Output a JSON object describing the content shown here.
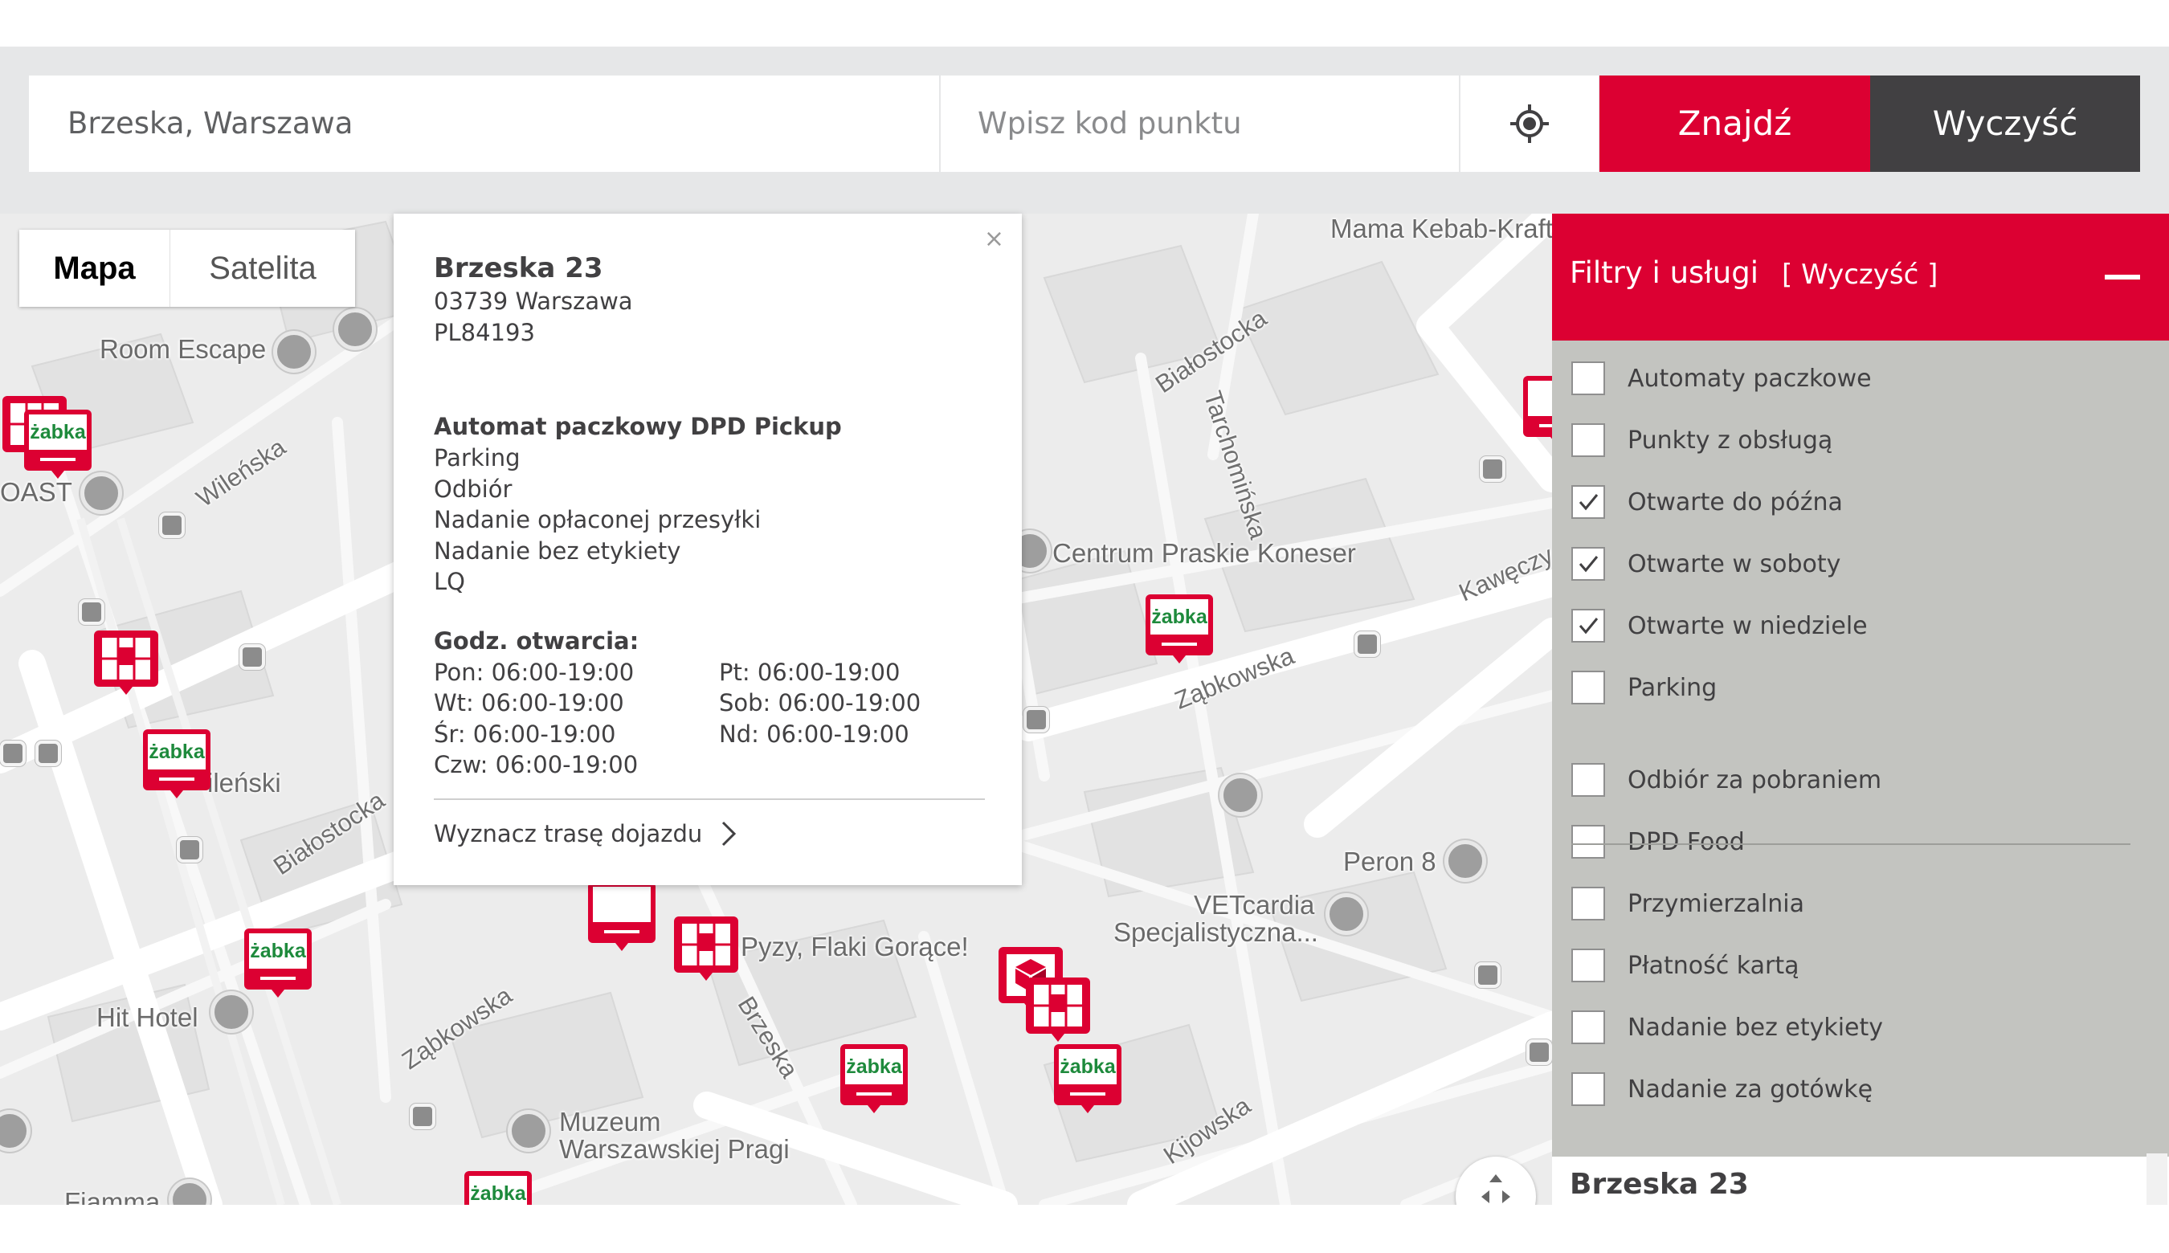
{
  "search": {
    "address_value": "Brzeska, Warszawa",
    "code_placeholder": "Wpisz kod punktu",
    "locate_icon": "crosshair-icon",
    "find_label": "Znajdź",
    "clear_label": "Wyczyść"
  },
  "colors": {
    "brand_red": "#dc0032",
    "dark_gray": "#414042",
    "filter_bg": "#c3c4c0",
    "zabka_green": "#1e8a3c"
  },
  "map": {
    "type_tabs": [
      "Mapa",
      "Satelita"
    ],
    "active_tab": "Mapa",
    "labels": {
      "room_escape": "Room Escape",
      "toast": "OAST",
      "wilenska": "Wileńska",
      "wilenski": "ileński",
      "bialostocka_bottom": "Białostocka",
      "hit_hotel": "Hit Hotel",
      "zabkowska_bottom": "Ząbkowska",
      "brzeska": "Brzeska",
      "pyzy": "Pyzy, Flaki Gorące!",
      "muzeum_1": "Muzeum",
      "muzeum_2": "Warszawskiej Pragi",
      "fiamma": "Fiamma",
      "mama_kebab": "Mama Kebab-Kraft",
      "bialostocka_top": "Białostocka",
      "tarchominska": "Tarchomińska",
      "koneser": "Centrum Praskie Koneser",
      "kaweczynska": "Kawęczy",
      "zabkowska_top": "Ząbkowska",
      "peron8": "Peron 8",
      "vetcardia_1": "VETcardia",
      "vetcardia_2": "Specjalistyczna...",
      "kijowska": "Kijowska",
      "zabka_logo": "żabka"
    }
  },
  "popup": {
    "close": "×",
    "name": "Brzeska 23",
    "city": "03739 Warszawa",
    "code": "PL84193",
    "type": "Automat paczkowy DPD Pickup",
    "services": [
      "Parking",
      "Odbiór",
      "Nadanie opłaconej przesyłki",
      "Nadanie bez etykiety",
      "LQ"
    ],
    "hours_title": "Godz. otwarcia:",
    "hours": [
      "Pon: 06:00-19:00",
      "Pt: 06:00-19:00",
      "Wt: 06:00-19:00",
      "Sob: 06:00-19:00",
      "Śr: 06:00-19:00",
      "Nd: 06:00-19:00",
      "Czw: 06:00-19:00"
    ],
    "route_label": "Wyznacz trasę dojazdu"
  },
  "filters": {
    "title": "Filtry i usługi",
    "clear_label": "[ Wyczyść ]",
    "items": [
      {
        "label": "Automaty paczkowe",
        "checked": false
      },
      {
        "label": "Punkty z obsługą",
        "checked": false
      },
      {
        "label": "Otwarte do późna",
        "checked": true
      },
      {
        "label": "Otwarte w soboty",
        "checked": true
      },
      {
        "label": "Otwarte w niedziele",
        "checked": true
      },
      {
        "label": "Parking",
        "checked": false
      },
      {
        "label": "Odbiór za pobraniem",
        "checked": false
      },
      {
        "label": "DPD Food",
        "checked": false
      },
      {
        "label": "Przymierzalnia",
        "checked": false
      },
      {
        "label": "Płatność kartą",
        "checked": false
      },
      {
        "label": "Nadanie bez etykiety",
        "checked": false
      },
      {
        "label": "Nadanie za gotówkę",
        "checked": false
      }
    ],
    "next_result_cut": "Brzeska 23"
  }
}
